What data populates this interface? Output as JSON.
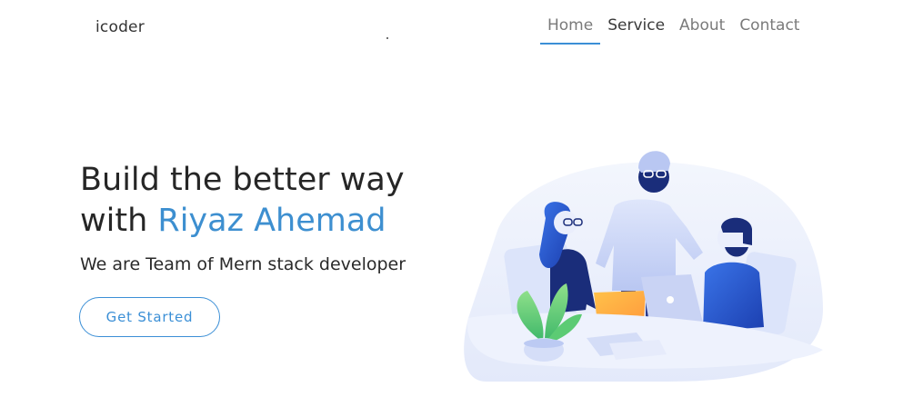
{
  "header": {
    "logo": "icoder",
    "nav": [
      "Home",
      "Service",
      "About",
      "Contact"
    ]
  },
  "hero": {
    "title_line1": "Build the better way",
    "title_line2_prefix": "with ",
    "title_name": "Riyaz Ahemad",
    "subtitle": "We are Team of Mern stack developer",
    "cta_label": "Get Started"
  },
  "colors": {
    "accent": "#3b8fd6",
    "text": "#262626",
    "nav_text": "#7a7a7a"
  }
}
